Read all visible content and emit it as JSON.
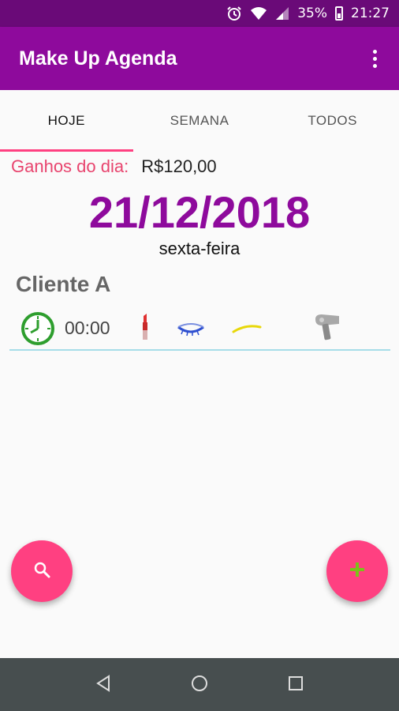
{
  "status_bar": {
    "battery_percent": "35%",
    "time": "21:27",
    "icons": [
      "alarm-icon",
      "wifi-icon",
      "signal-icon",
      "battery-icon"
    ]
  },
  "app_bar": {
    "title": "Make Up Agenda",
    "menu_icon": "more-vert-icon"
  },
  "tabs": [
    {
      "label": "HOJE",
      "active": true
    },
    {
      "label": "SEMANA",
      "active": false
    },
    {
      "label": "TODOS",
      "active": false
    }
  ],
  "earnings": {
    "label": "Ganhos do dia:",
    "value": "R$120,00"
  },
  "date": {
    "full": "21/12/2018",
    "weekday": "sexta-feira"
  },
  "appointments": [
    {
      "client": "Cliente A",
      "time": "00:00",
      "services": [
        "lipstick-icon",
        "eyelashes-icon",
        "eyebrow-icon",
        "hair-dryer-icon"
      ]
    }
  ],
  "fabs": {
    "left_icon": "search-icon",
    "right_icon": "add-icon"
  },
  "nav_bar": {
    "buttons": [
      "back-icon",
      "home-icon",
      "recents-icon"
    ]
  },
  "colors": {
    "status_bar": "#6a0a78",
    "app_bar": "#8e0a9c",
    "accent": "#ff4081",
    "date_color": "#8e0a9c",
    "earnings_label": "#e8446e",
    "divider": "#a6dde8",
    "nav_bar": "#474e4f"
  }
}
